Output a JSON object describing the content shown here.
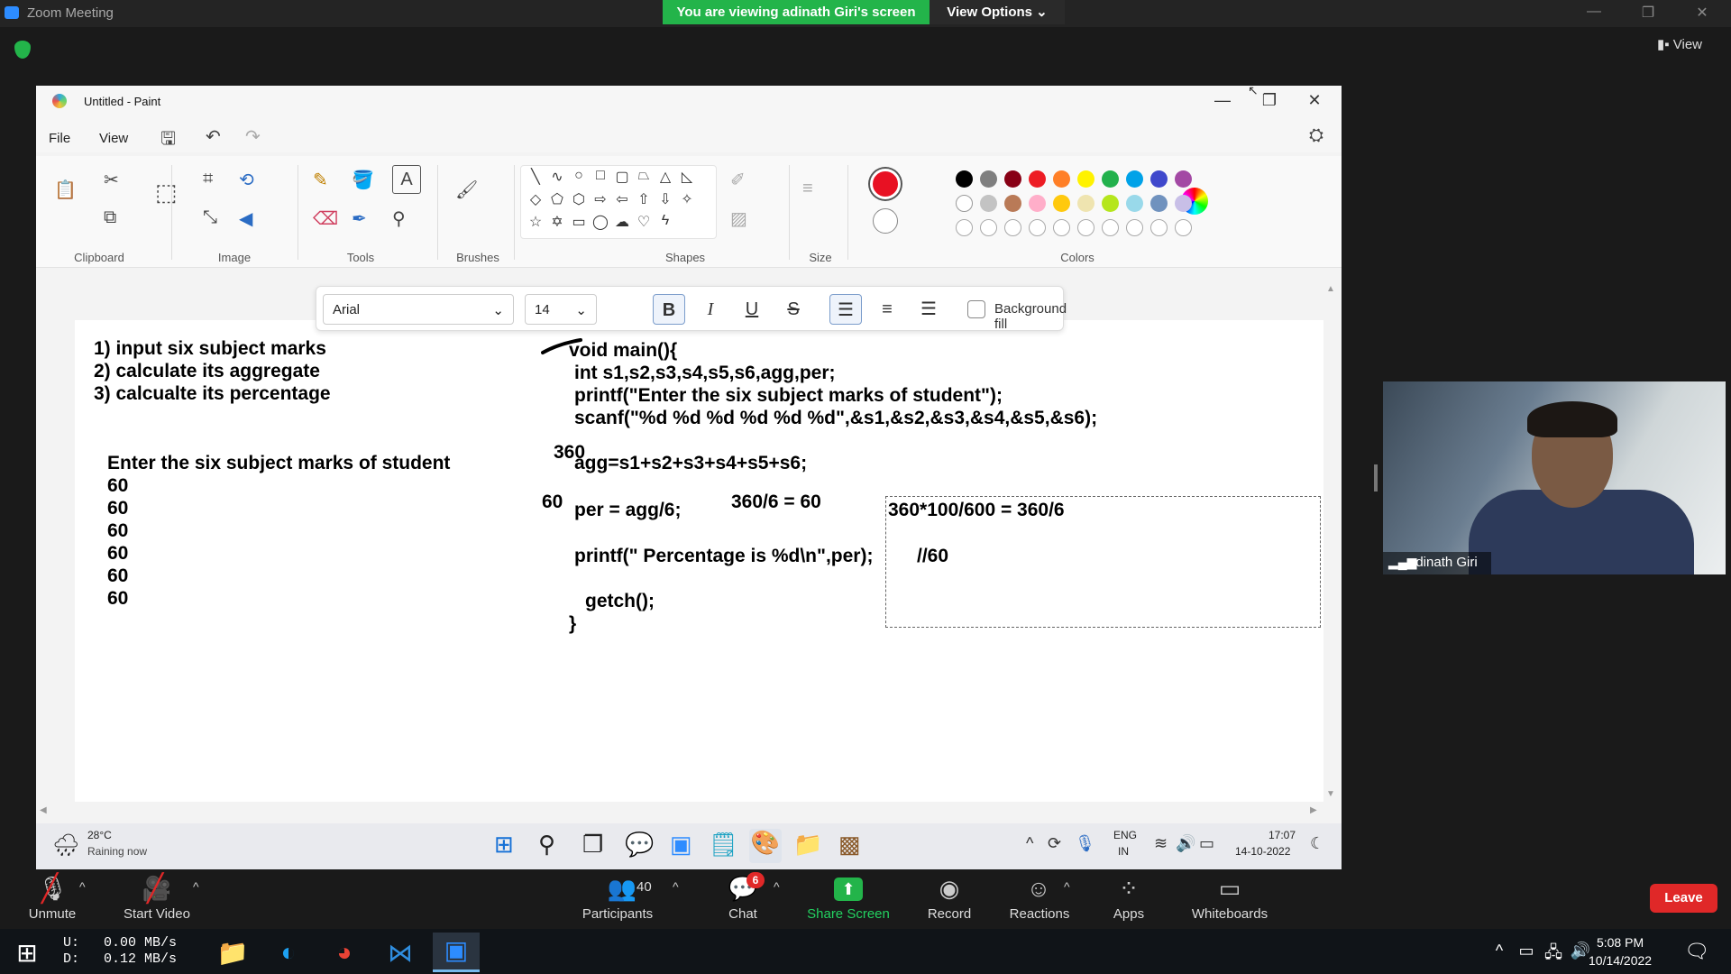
{
  "zoom": {
    "window_title": "Zoom Meeting",
    "viewing_banner": "You are viewing adinath Giri's screen",
    "view_options": "View Options ⌄",
    "view_button": "View",
    "participant_count": "40",
    "chat_badge": "6",
    "controls": {
      "unmute": "Unmute",
      "start_video": "Start Video",
      "participants": "Participants",
      "chat": "Chat",
      "share_screen": "Share Screen",
      "record": "Record",
      "reactions": "Reactions",
      "apps": "Apps",
      "whiteboards": "Whiteboards",
      "leave": "Leave"
    },
    "video_name": "adinath Giri"
  },
  "paint": {
    "title": "Untitled - Paint",
    "menu": {
      "file": "File",
      "view": "View"
    },
    "groups": {
      "clipboard": "Clipboard",
      "image": "Image",
      "tools": "Tools",
      "brushes": "Brushes",
      "shapes": "Shapes",
      "size": "Size",
      "colors": "Colors"
    },
    "colors_row1": [
      "#000000",
      "#7f7f7f",
      "#880015",
      "#ed1c24",
      "#ff7f27",
      "#fff200",
      "#22b14c",
      "#00a2e8",
      "#3f48cc",
      "#a349a4"
    ],
    "colors_row2": [
      "#ffffff",
      "#c3c3c3",
      "#b97a57",
      "#ffaec9",
      "#ffc90e",
      "#efe4b0",
      "#b5e61d",
      "#99d9ea",
      "#7092be",
      "#c8bfe7"
    ],
    "primary_color": "#e81123",
    "text_toolbar": {
      "font": "Arial",
      "size": "14",
      "background_fill": "Background fill"
    },
    "canvas_text": {
      "task1": "1) input six subject marks",
      "task2": "2) calculate its aggregate",
      "task3": "3) calcualte its percentage",
      "prompt": "Enter the six subject marks of student",
      "marks": [
        "60",
        "60",
        "60",
        "60",
        "60",
        "60"
      ],
      "code1": "void main(){",
      "code2": "int s1,s2,s3,s4,s5,s6,agg,per;",
      "code3": "printf(\"Enter the six subject marks of student\");",
      "code4": "scanf(\"%d %d %d %d %d %d\",&s1,&s2,&s3,&s4,&s5,&s6);",
      "note360": "360",
      "code5": "agg=s1+s2+s3+s4+s5+s6;",
      "note60": "60",
      "code6": "per = agg/6;",
      "calc1": "360/6 = 60",
      "calc2": "360*100/600  = 360/6",
      "code7": "printf(\" Percentage is  %d\\n\",per);",
      "comment": "//60",
      "code8": "getch();",
      "code9": "}"
    }
  },
  "inner_taskbar": {
    "weather_temp": "28°C",
    "weather_desc": "Raining now",
    "lang1": "ENG",
    "lang2": "IN",
    "time": "17:07",
    "date": "14-10-2022"
  },
  "win_taskbar": {
    "upload_label": "U:",
    "upload": "0.00 MB/s",
    "download_label": "D:",
    "download": "0.12 MB/s",
    "time": "5:08 PM",
    "date": "10/14/2022"
  }
}
